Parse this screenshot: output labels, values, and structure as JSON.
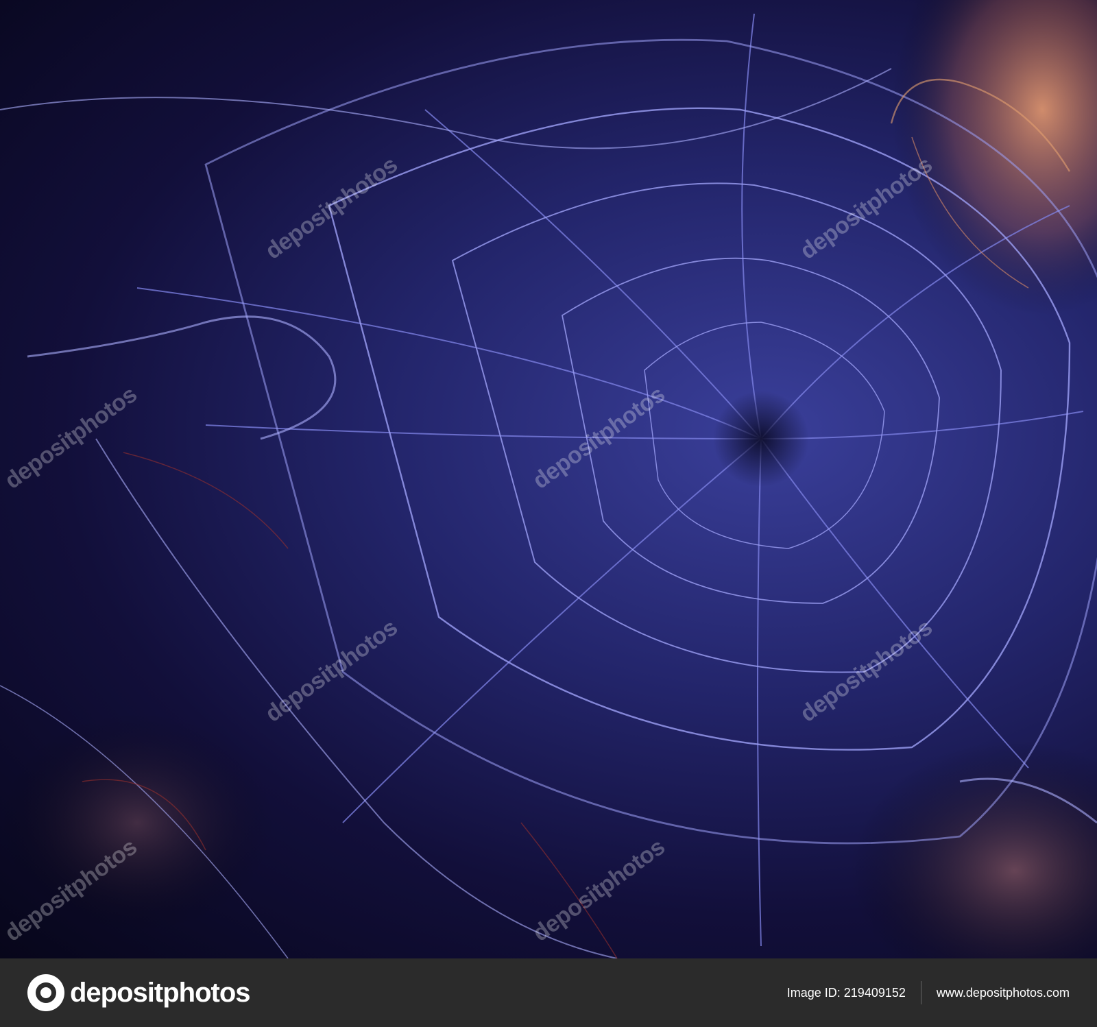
{
  "watermark": {
    "text": "depositphotos"
  },
  "footer": {
    "brand": "depositphotos",
    "image_id_label": "Image ID: 219409152",
    "site_url": "www.depositphotos.com"
  },
  "colors": {
    "web_strands": "#8c8ff0",
    "web_bright": "#b9bcff",
    "accent_orange": "#e08a5a",
    "accent_red": "#a0322c",
    "footer_bg": "#2b2b2b"
  }
}
